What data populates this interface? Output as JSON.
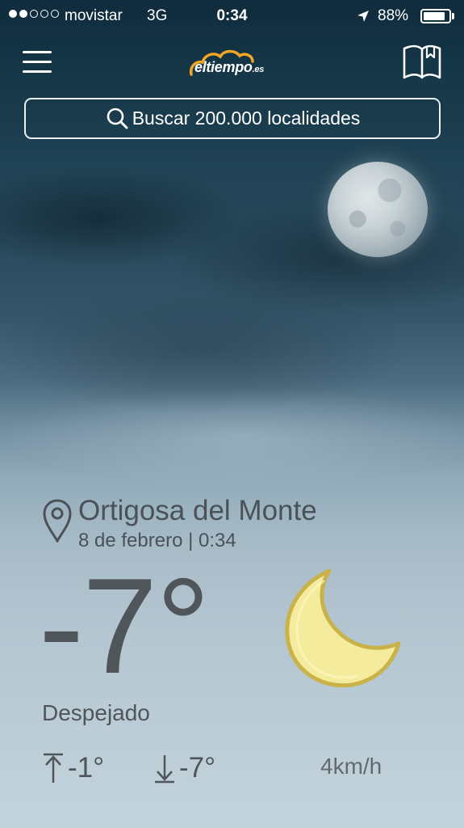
{
  "status_bar": {
    "carrier": "movistar",
    "network": "3G",
    "time": "0:34",
    "battery_percent": "88%",
    "battery_level": 0.88,
    "signal_bars_filled": 2,
    "signal_bars_total": 5
  },
  "nav": {
    "logo_text": "eltiempo",
    "logo_suffix": ".es",
    "menu_icon": "hamburger-menu-icon",
    "bookmark_icon": "bookmark-book-icon"
  },
  "search": {
    "placeholder": "Buscar 200.000 localidades",
    "icon": "search-icon"
  },
  "weather": {
    "location": "Ortigosa del Monte",
    "date": "8 de febrero | 0:34",
    "temperature": "-7°",
    "condition": "Despejado",
    "max_temp": "-1°",
    "min_temp": "-7°",
    "wind": "4km/h",
    "condition_icon": "crescent-moon-icon"
  },
  "colors": {
    "text_dark": "#4f5559",
    "moon_yellow": "#f4ec9c",
    "moon_outline": "#c9b24a"
  }
}
